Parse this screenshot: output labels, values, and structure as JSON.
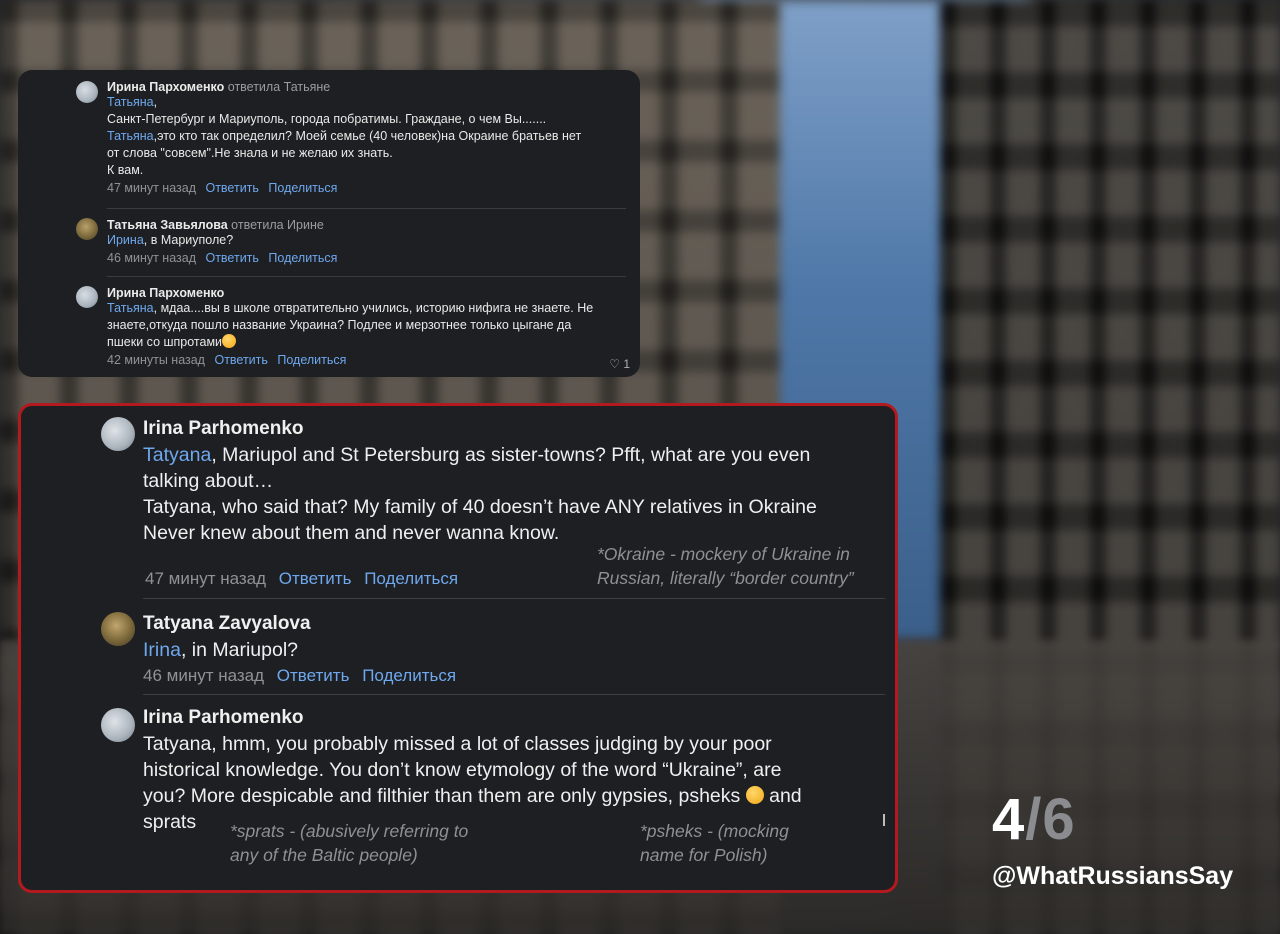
{
  "original": {
    "comments": [
      {
        "author": "Ирина Пархоменко",
        "reply_to": "ответила Татьяне",
        "lines": [
          {
            "link": "Татьяна",
            "text": ","
          },
          {
            "link": "",
            "text": "Санкт-Петербург и Мариуполь, города побратимы. Граждане, о чем Вы......."
          },
          {
            "link": "Татьяна",
            "text": ",это кто так определил? Моей семье (40 человек)на Окраине братьев нет"
          },
          {
            "link": "",
            "text": "от слова \"совсем\".Не знала и не желаю их знать."
          },
          {
            "link": "",
            "text": "К вам."
          }
        ],
        "time": "47 минут назад",
        "reply": "Ответить",
        "share": "Поделиться"
      },
      {
        "author": "Татьяна Завьялова",
        "reply_to": "ответила Ирине",
        "lines": [
          {
            "link": "Ирина",
            "text": ", в Мариуполе?"
          }
        ],
        "time": "46 минут назад",
        "reply": "Ответить",
        "share": "Поделиться"
      },
      {
        "author": "Ирина Пархоменко",
        "reply_to": "",
        "lines": [
          {
            "link": "Татьяна",
            "text": ", мдаа....вы в школе отвратительно учились, историю нифига не знаете. Не"
          },
          {
            "link": "",
            "text": "знаете,откуда пошло название Украина? Подлее и мерзотнее только цыгане да"
          },
          {
            "link": "",
            "text": "пшеки со шпротами"
          }
        ],
        "time": "42 минуты назад",
        "reply": "Ответить",
        "share": "Поделиться",
        "likes": "1"
      }
    ]
  },
  "translated": {
    "comments": [
      {
        "author": "Irina Parhomenko",
        "link": "Tatyana",
        "line1_rest": ", Mariupol and St Petersburg as sister-towns? Pfft, what are you even",
        "line2": "talking about…",
        "line3": "Tatyana, who said that? My family of 40 doesn’t have ANY relatives in Okraine",
        "line4": "Never knew about them and never wanna know.",
        "note1": "*Okraine - mockery of Ukraine in",
        "note2": "Russian, literally “border country”",
        "time": "47 минут назад",
        "reply": "Ответить",
        "share": "Поделиться"
      },
      {
        "author": "Tatyana Zavyalova",
        "link": "Irina",
        "line1_rest": ", in Mariupol?",
        "time": "46 минут назад",
        "reply": "Ответить",
        "share": "Поделиться"
      },
      {
        "author": "Irina Parhomenko",
        "line1": "Tatyana, hmm, you probably missed a lot of classes judging by your poor",
        "line2": "historical knowledge. You don’t know etymology of the word “Ukraine”, are",
        "line3_a": "you? More despicable and filthier than them are only gypsies, psheks",
        "line3_b": " and",
        "line4": "sprats",
        "note_sprats1": "*sprats - (abusively referring to",
        "note_sprats2": "any of the Baltic people)",
        "note_psheks1": "*psheks - (mocking",
        "note_psheks2": "name for Polish)"
      }
    ]
  },
  "watermark": {
    "current": "4",
    "slash": "/",
    "total": "6",
    "handle": "@WhatRussiansSay"
  },
  "icons": {
    "heart": "heart-icon",
    "emoji": "smirking-face-icon"
  },
  "colors": {
    "link": "#6ea8ee",
    "highlight_border": "#b31a1f",
    "card_bg": "#1e1f22"
  }
}
